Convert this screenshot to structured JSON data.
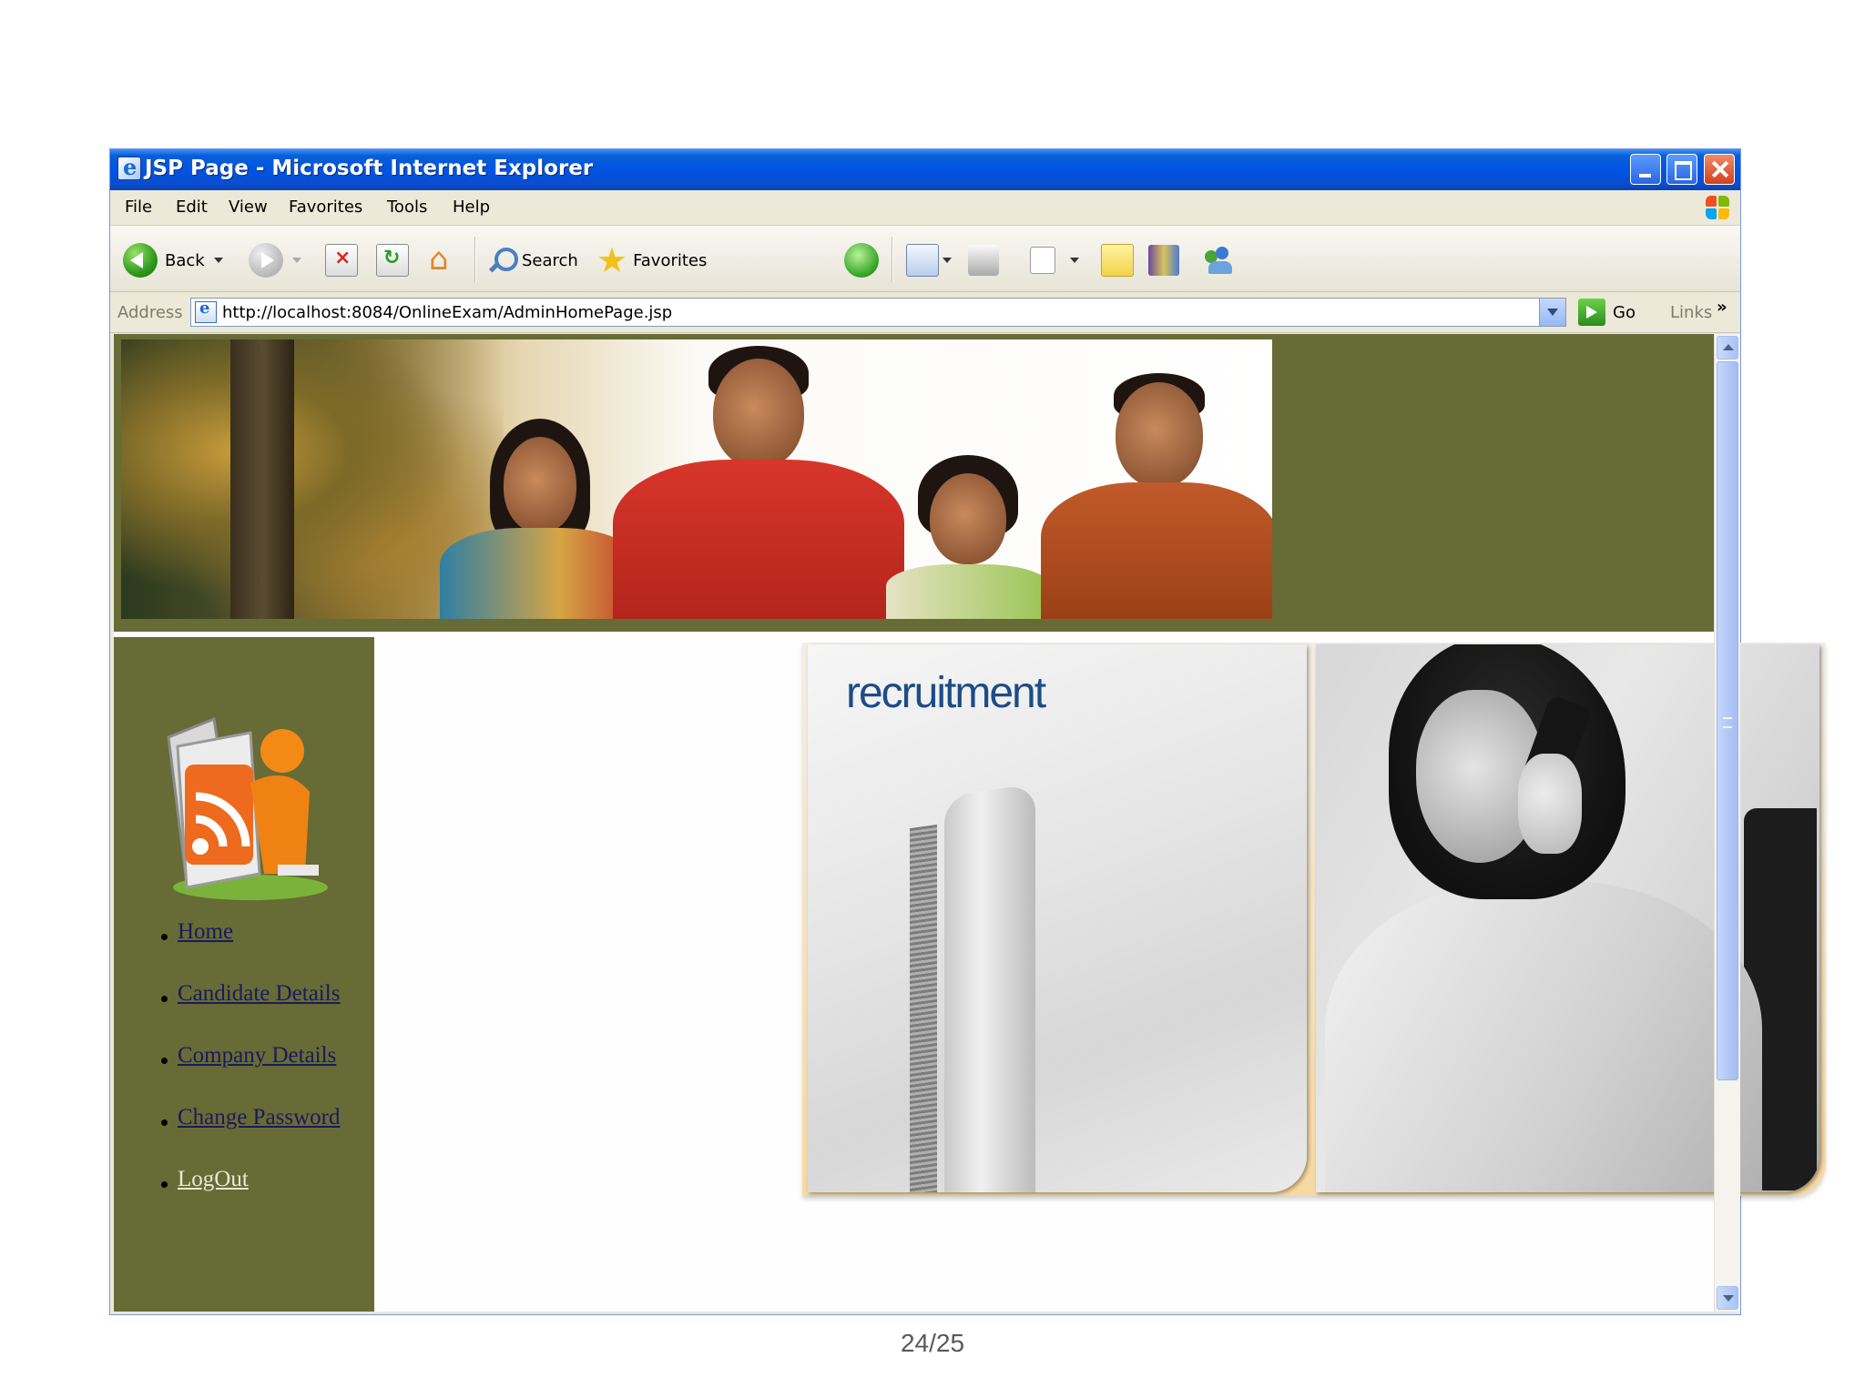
{
  "window": {
    "title": "JSP Page - Microsoft Internet Explorer"
  },
  "menu": [
    "File",
    "Edit",
    "View",
    "Favorites",
    "Tools",
    "Help"
  ],
  "toolbar": {
    "back_label": "Back",
    "search_label": "Search",
    "favorites_label": "Favorites"
  },
  "address": {
    "label": "Address",
    "url": "http://localhost:8084/OnlineExam/AdminHomePage.jsp",
    "go_label": "Go",
    "links_label": "Links",
    "links_chevron": "»"
  },
  "recruitment": {
    "title": "recruitment"
  },
  "nav": [
    {
      "label": "Home",
      "visited": false
    },
    {
      "label": "Candidate Details",
      "visited": false
    },
    {
      "label": "Company Details",
      "visited": false
    },
    {
      "label": "Change Password",
      "visited": false
    },
    {
      "label": "LogOut",
      "visited": true
    }
  ],
  "page_number": "24/25",
  "colors": {
    "olive": "#676b35",
    "link": "#1a1a5e",
    "visited_link": "#e9e9d5",
    "title_bar": "#0054e3"
  },
  "icons": [
    "ie-icon",
    "minimize-icon",
    "maximize-icon",
    "close-icon",
    "windows-logo-icon",
    "back-icon",
    "forward-icon",
    "stop-icon",
    "refresh-icon",
    "home-icon",
    "search-icon",
    "favorites-star-icon",
    "history-icon",
    "mail-icon",
    "print-icon",
    "edit-icon",
    "notes-icon",
    "research-icon",
    "messenger-icon",
    "page-icon",
    "go-arrow-icon",
    "rss-reader-icon"
  ]
}
